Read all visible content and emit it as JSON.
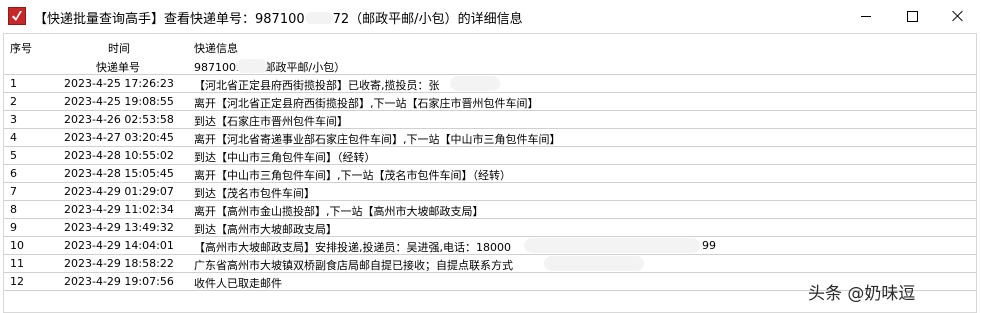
{
  "window": {
    "title": "【快递批量查询高手】查看快递单号：98710037 2（邮政平邮/小包）的详细信息",
    "title_prefix": "【快递批量查询高手】查看快递单号：987100",
    "title_suffix": "72（邮政平邮/小包）的详细信息",
    "icon": "app-checkmark-icon"
  },
  "columns": {
    "no": "序号",
    "time": "时间",
    "info": "快递信息"
  },
  "tracking": {
    "label": "快递单号",
    "value": "9871003    2（邮政平邮/小包）"
  },
  "rows": [
    {
      "no": "1",
      "time": "2023-4-25 17:26:23",
      "info": "【河北省正定县府西街揽投部】已收寄,揽投员：张"
    },
    {
      "no": "2",
      "time": "2023-4-25 19:08:55",
      "info": "离开【河北省正定县府西街揽投部】,下一站【石家庄市晋州包件车间】"
    },
    {
      "no": "3",
      "time": "2023-4-26 02:53:58",
      "info": "到达【石家庄市晋州包件车间】"
    },
    {
      "no": "4",
      "time": "2023-4-27 03:20:45",
      "info": "离开【河北省寄递事业部石家庄包件车间】,下一站【中山市三角包件车间】"
    },
    {
      "no": "5",
      "time": "2023-4-28 10:55:02",
      "info": "到达【中山市三角包件车间】（经转）"
    },
    {
      "no": "6",
      "time": "2023-4-28 15:05:45",
      "info": "离开【中山市三角包件车间】,下一站【茂名市包件车间】（经转）"
    },
    {
      "no": "7",
      "time": "2023-4-29 01:29:07",
      "info": "到达【茂名市包件车间】"
    },
    {
      "no": "8",
      "time": "2023-4-29 11:02:34",
      "info": "离开【高州市金山揽投部】,下一站【高州市大坡邮政支局】"
    },
    {
      "no": "9",
      "time": "2023-4-29 13:49:32",
      "info": "到达【高州市大坡邮政支局】"
    },
    {
      "no": "10",
      "time": "2023-4-29 14:04:01",
      "info": "【高州市大坡邮政支局】安排投递,投递员：吴进强,电话：18000",
      "info_tail": "99"
    },
    {
      "no": "11",
      "time": "2023-4-29 18:58:22",
      "info": "广东省高州市大坡镇双桥副食店局邮自提已接收；自提点联系方式"
    },
    {
      "no": "12",
      "time": "2023-4-29 19:07:56",
      "info": "收件人已取走邮件"
    }
  ],
  "watermark": "头条 @奶味逗"
}
